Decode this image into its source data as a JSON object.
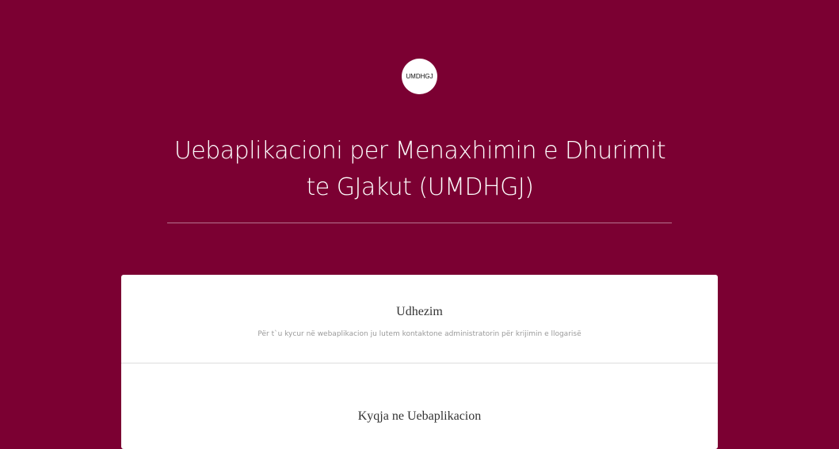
{
  "logo": {
    "text": "UMDHGJ"
  },
  "header": {
    "title_line1": "Uebaplikacioni per Menaxhimin e Dhurimit",
    "title_line2": "te GJakut (UMDHGJ)"
  },
  "instructions": {
    "heading": "Udhezim",
    "text": "Për t`u kycur në webaplikacion ju lutem kontaktone administratorin për krijimin e llogarisë"
  },
  "login": {
    "heading": "Kyqja ne Uebaplikacion"
  },
  "colors": {
    "background": "#7b0032",
    "card": "#ffffff"
  }
}
